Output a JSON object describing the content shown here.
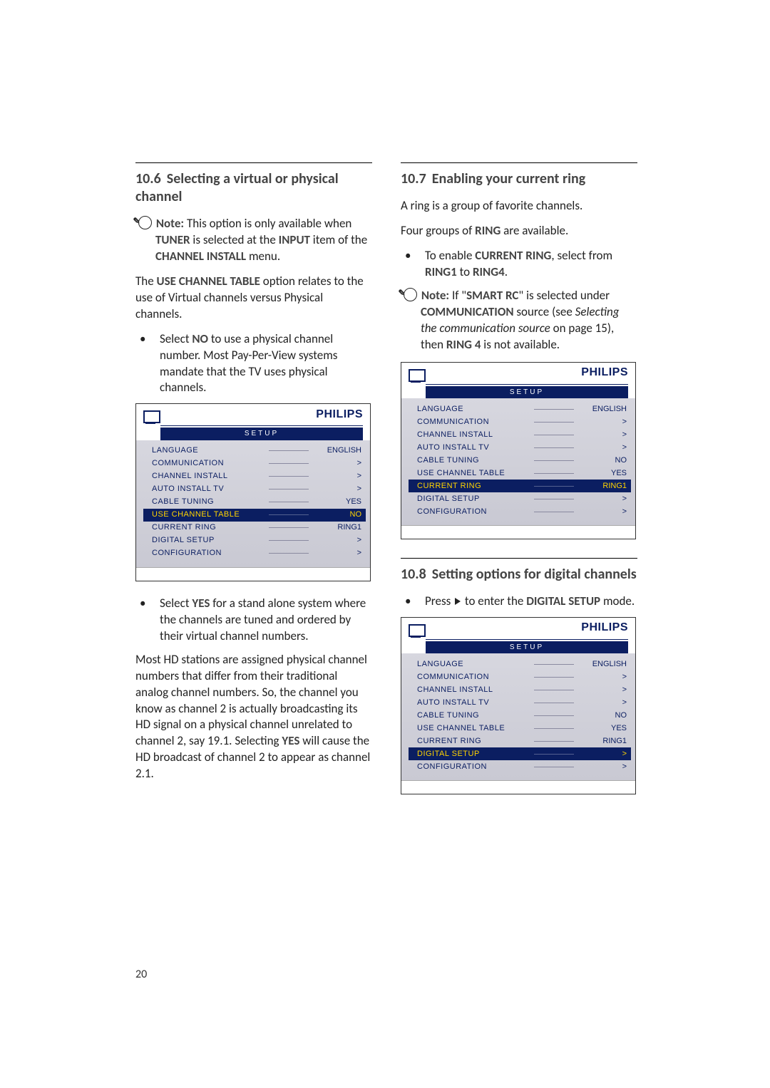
{
  "page_number": "20",
  "left": {
    "heading_num": "10.6",
    "heading_text": "Selecting a virtual or physical channel",
    "note_label": "Note:",
    "note_body_a": " This option is only available when ",
    "note_bold1": "TUNER",
    "note_body_b": " is selected at the ",
    "note_bold2": "INPUT",
    "note_body_c": " item of the ",
    "note_bold3": "CHANNEL INSTALL",
    "note_body_d": " menu.",
    "p1_a": "The ",
    "p1_bold": "USE CHANNEL TABLE",
    "p1_b": " option relates to the use of Virtual channels versus Physical channels.",
    "b1_a": "Select ",
    "b1_bold": "NO",
    "b1_b": " to use a physical channel number. Most Pay-Per-View systems mandate that the TV uses physical channels.",
    "b2_a": "Select ",
    "b2_bold": "YES",
    "b2_b": " for a stand alone system where the channels are tuned and ordered by their virtual channel numbers.",
    "p2_a": "Most HD stations are assigned physical channel numbers that differ from their traditional analog channel numbers. So, the channel you know as channel 2 is actually broadcasting its HD signal on a physical channel unrelated to channel 2, say 19.1. Selecting ",
    "p2_bold": "YES",
    "p2_b": " will cause the HD broadcast of channel 2 to appear as channel 2.1."
  },
  "right": {
    "h1_num": "10.7",
    "h1_text": "Enabling your current ring",
    "p1": "A ring is a group of favorite channels.",
    "p2_a": "Four groups of ",
    "p2_bold": "RING",
    "p2_b": " are available.",
    "b1_a": "To enable ",
    "b1_bold1": "CURRENT RING",
    "b1_b": ", select from ",
    "b1_bold2": "RING1",
    "b1_c": " to ",
    "b1_bold3": "RING4",
    "b1_d": ".",
    "note_label": "Note:",
    "note_a": " If \"",
    "note_bold1": "SMART RC",
    "note_b": "\" is selected under ",
    "note_bold2": "COMMUNICATION",
    "note_c": " source (see ",
    "note_ital": "Selecting the communication source",
    "note_d": " on page 15), then ",
    "note_bold3": "RING 4",
    "note_e": " is not available.",
    "h2_num": "10.8",
    "h2_text": "Setting options for digital channels",
    "b2_a": "Press ",
    "b2_b": " to enter the ",
    "b2_bold": "DIGITAL SETUP",
    "b2_c": " mode."
  },
  "brand": "PHILIPS",
  "menu_title": "SETUP",
  "menu_items": [
    {
      "label": "LANGUAGE",
      "value": "ENGLISH"
    },
    {
      "label": "COMMUNICATION",
      "value": ">"
    },
    {
      "label": "CHANNEL INSTALL",
      "value": ">"
    },
    {
      "label": "AUTO INSTALL TV",
      "value": ">"
    },
    {
      "label": "CABLE TUNING",
      "value": "YES"
    },
    {
      "label": "USE CHANNEL TABLE",
      "value": "NO"
    },
    {
      "label": "CURRENT RING",
      "value": "RING1"
    },
    {
      "label": "DIGITAL SETUP",
      "value": ">"
    },
    {
      "label": "CONFIGURATION",
      "value": ">"
    }
  ],
  "menu_b_items": [
    {
      "label": "LANGUAGE",
      "value": "ENGLISH"
    },
    {
      "label": "COMMUNICATION",
      "value": ">"
    },
    {
      "label": "CHANNEL INSTALL",
      "value": ">"
    },
    {
      "label": "AUTO INSTALL TV",
      "value": ">"
    },
    {
      "label": "CABLE TUNING",
      "value": "NO"
    },
    {
      "label": "USE CHANNEL TABLE",
      "value": "YES"
    },
    {
      "label": "CURRENT RING",
      "value": "RING1"
    },
    {
      "label": "DIGITAL SETUP",
      "value": ">"
    },
    {
      "label": "CONFIGURATION",
      "value": ">"
    }
  ],
  "menu_c_items": [
    {
      "label": "LANGUAGE",
      "value": "ENGLISH"
    },
    {
      "label": "COMMUNICATION",
      "value": ">"
    },
    {
      "label": "CHANNEL INSTALL",
      "value": ">"
    },
    {
      "label": "AUTO INSTALL TV",
      "value": ">"
    },
    {
      "label": "CABLE TUNING",
      "value": "NO"
    },
    {
      "label": "USE CHANNEL TABLE",
      "value": "YES"
    },
    {
      "label": "CURRENT RING",
      "value": "RING1"
    },
    {
      "label": "DIGITAL SETUP",
      "value": ">"
    },
    {
      "label": "CONFIGURATION",
      "value": ">"
    }
  ],
  "highlight": {
    "a": 5,
    "b": 6,
    "c": 7
  }
}
